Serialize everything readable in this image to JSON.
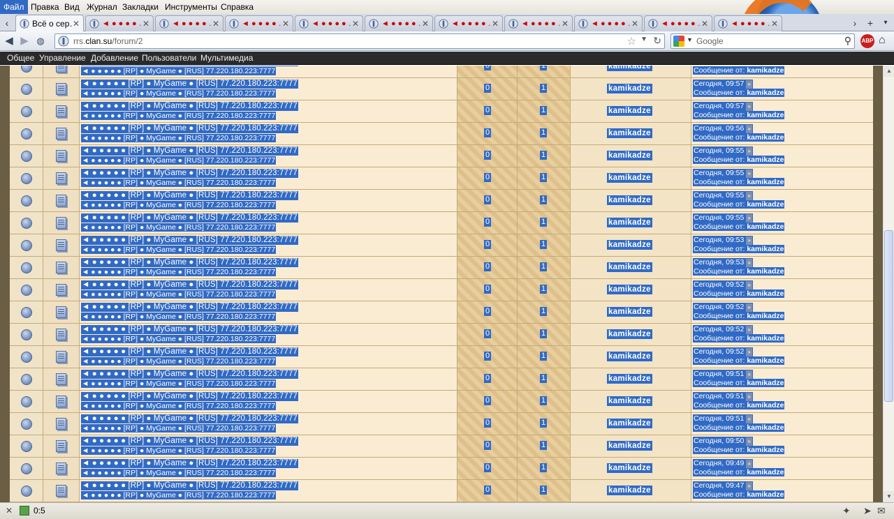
{
  "menubar": {
    "items": [
      "Файл",
      "Правка",
      "Вид",
      "Журнал",
      "Закладки",
      "Инструменты",
      "Справка"
    ]
  },
  "tabs": {
    "selected_title": "Всё о сер…",
    "other_title": "◄ ● ● ● ● …",
    "count": 11
  },
  "navbar": {
    "url_prefix": "rrs.",
    "url_domain": "clan.su",
    "url_path": "/forum/2",
    "search_placeholder": "Google",
    "abp_label": "ABP"
  },
  "admin": {
    "items": [
      "Общее",
      "Управление",
      "Добавление",
      "Пользователи",
      "Мультимедиа"
    ]
  },
  "topic": {
    "title": "◄ ● ● ● ● ● [RP] ● MyGame ● [RUS] 77.220.180.223:7777",
    "subtitle": "◄ ● ● ● ● ● [RP] ● MyGame ● [RUS] 77.220.180.223:7777",
    "replies": "0",
    "views": "1",
    "author": "kamikadze",
    "last_prefix": "Сообщение от:",
    "last_user": "kamikadze"
  },
  "rows": [
    {
      "time": ""
    },
    {
      "time": "Сегодня, 09:57"
    },
    {
      "time": "Сегодня, 09:57"
    },
    {
      "time": "Сегодня, 09:56"
    },
    {
      "time": "Сегодня, 09:55"
    },
    {
      "time": "Сегодня, 09:55"
    },
    {
      "time": "Сегодня, 09:55"
    },
    {
      "time": "Сегодня, 09:55"
    },
    {
      "time": "Сегодня, 09:53"
    },
    {
      "time": "Сегодня, 09:53"
    },
    {
      "time": "Сегодня, 09:52"
    },
    {
      "time": "Сегодня, 09:52"
    },
    {
      "time": "Сегодня, 09:52"
    },
    {
      "time": "Сегодня, 09:52"
    },
    {
      "time": "Сегодня, 09:51"
    },
    {
      "time": "Сегодня, 09:51"
    },
    {
      "time": "Сегодня, 09:51"
    },
    {
      "time": "Сегодня, 09:50"
    },
    {
      "time": "Сегодня, 09:49"
    },
    {
      "time": "Сегодня, 09:47"
    }
  ],
  "status": {
    "text": "0:5"
  },
  "colors": {
    "selection": "#316ac5",
    "forum_bg": "#f9ecd2",
    "admin_bg": "#2b2b2b"
  }
}
